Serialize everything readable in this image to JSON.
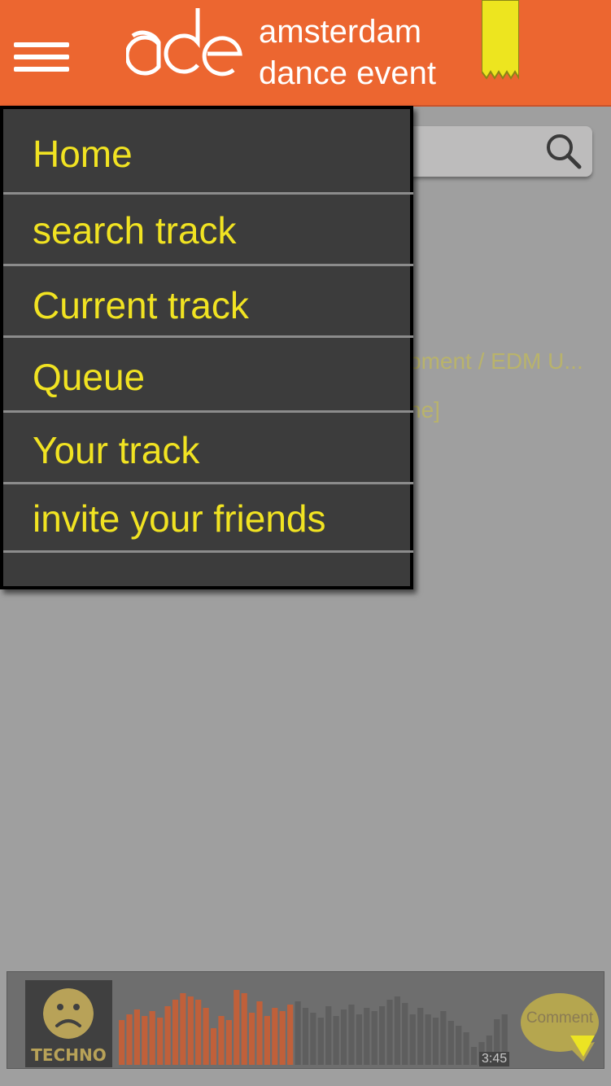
{
  "header": {
    "brand_line1": "amsterdam",
    "brand_line2": "dance event",
    "logo_text": "ade"
  },
  "search": {
    "icon": "search-icon"
  },
  "background_content": {
    "line1": "pment / EDM U...",
    "line2": "ne]"
  },
  "menu": {
    "items": [
      {
        "label": "Home"
      },
      {
        "label": "search track"
      },
      {
        "label": "Current track"
      },
      {
        "label": "Queue"
      },
      {
        "label": "Your track"
      },
      {
        "label": "invite your friends"
      }
    ]
  },
  "player": {
    "genre": "TECHNO",
    "time": "3:45",
    "comment_label": "Comment",
    "progress_fraction": 0.45
  },
  "colors": {
    "header": "#ec6630",
    "accent_yellow": "#f1e322",
    "menu_bg": "#3c3c3c",
    "played_wave": "#c0603a",
    "unplayed_wave": "#5e5e5e"
  }
}
